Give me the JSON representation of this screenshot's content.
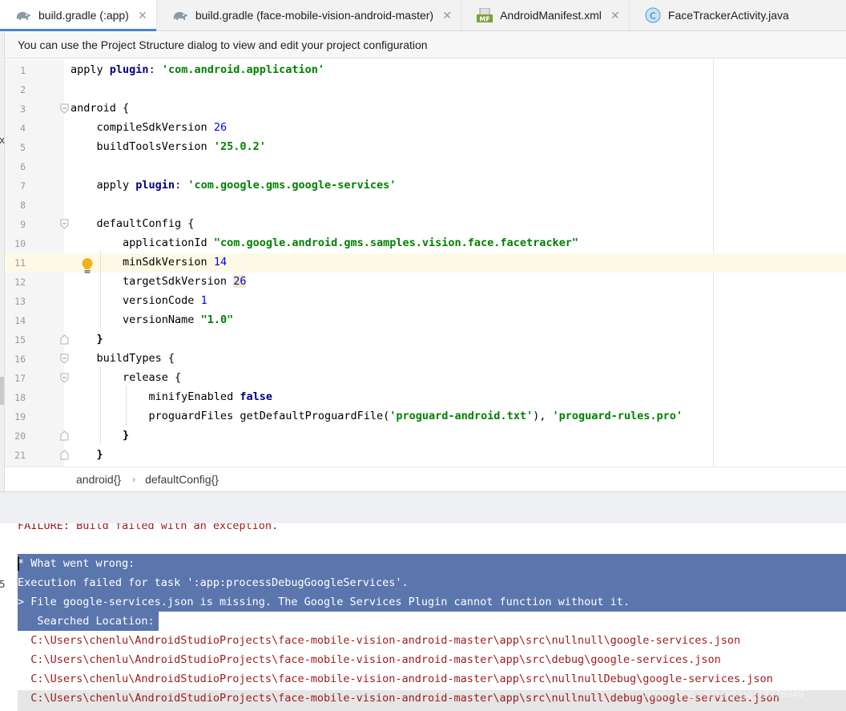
{
  "tabs": [
    {
      "label": "build.gradle (:app)",
      "icon": "gradle-elephant-icon",
      "active": true
    },
    {
      "label": "build.gradle (face-mobile-vision-android-master)",
      "icon": "gradle-elephant-icon",
      "active": false
    },
    {
      "label": "AndroidManifest.xml",
      "icon": "manifest-file-icon",
      "icon_text": "MF",
      "active": false
    },
    {
      "label": "FaceTrackerActivity.java",
      "icon": "java-class-icon",
      "icon_text": "C",
      "active": false
    }
  ],
  "close_glyph": "✕",
  "banner": "You can use the Project Structure dialog to view and edit your project configuration",
  "gutter": [
    "1",
    "2",
    "3",
    "4",
    "5",
    "6",
    "7",
    "8",
    "9",
    "10",
    "11",
    "12",
    "13",
    "14",
    "15",
    "16",
    "17",
    "18",
    "19",
    "20",
    "21"
  ],
  "code": {
    "l1": {
      "a": "apply ",
      "b": "plugin",
      "c": ": ",
      "d": "'com.android.application'"
    },
    "l3": "android {",
    "l4": {
      "a": "    compileSdkVersion ",
      "b": "26"
    },
    "l5": {
      "a": "    buildToolsVersion ",
      "b": "'25.0.2'"
    },
    "l7": {
      "a": "    apply ",
      "b": "plugin",
      "c": ": ",
      "d": "'com.google.gms.google-services'"
    },
    "l9": "    defaultConfig {",
    "l10": {
      "a": "        applicationId ",
      "b": "\"com.google.android.gms.samples.vision.face.facetracker\""
    },
    "l11": {
      "a": "        minSdkVersion ",
      "b": "14"
    },
    "l12": {
      "a": "        targetSdkVersion ",
      "b": "26"
    },
    "l13": {
      "a": "        versionCode ",
      "b": "1"
    },
    "l14": {
      "a": "        versionName ",
      "b": "\"1.0\""
    },
    "l15": "    }",
    "l16": "    buildTypes {",
    "l17": "        release {",
    "l18": {
      "a": "            minifyEnabled ",
      "b": "false"
    },
    "l19": {
      "a": "            proguardFiles getDefaultProguardFile(",
      "b": "'proguard-android.txt'",
      "c": "), ",
      "d": "'proguard-rules.pro'"
    },
    "l20": "        }",
    "l21": "    }"
  },
  "breadcrumb": {
    "item1": "android{}",
    "sep": "›",
    "item2": "defaultConfig{}"
  },
  "console": {
    "line0": "FAILURE: Build failed with an exception.",
    "line1": "* What went wrong:",
    "line2": "Execution failed for task ':app:processDebugGoogleServices'.",
    "line3": "> File google-services.json is missing. The Google Services Plugin cannot function without it.",
    "line4": "   Searched Location:",
    "line5": "  C:\\Users\\chenlu\\AndroidStudioProjects\\face-mobile-vision-android-master\\app\\src\\nullnull\\google-services.json",
    "line6": "  C:\\Users\\chenlu\\AndroidStudioProjects\\face-mobile-vision-android-master\\app\\src\\debug\\google-services.json",
    "line7": "  C:\\Users\\chenlu\\AndroidStudioProjects\\face-mobile-vision-android-master\\app\\src\\nullnullDebug\\google-services.json",
    "line8": "  C:\\Users\\chenlu\\AndroidStudioProjects\\face-mobile-vision-android-master\\app\\src\\nullnull\\debug\\google-services.json"
  },
  "watermark": "https://blog.csdn.net/qq_18276949",
  "sliver": {
    "c1": "x",
    "c2": "5"
  },
  "colors": {
    "keyword": "#000080",
    "string": "#008000",
    "number": "#0000ff",
    "error": "#9c1b1b",
    "selection": "#5a76ad",
    "current_line": "#fcfae6",
    "tab_underline": "#4a86c8"
  }
}
